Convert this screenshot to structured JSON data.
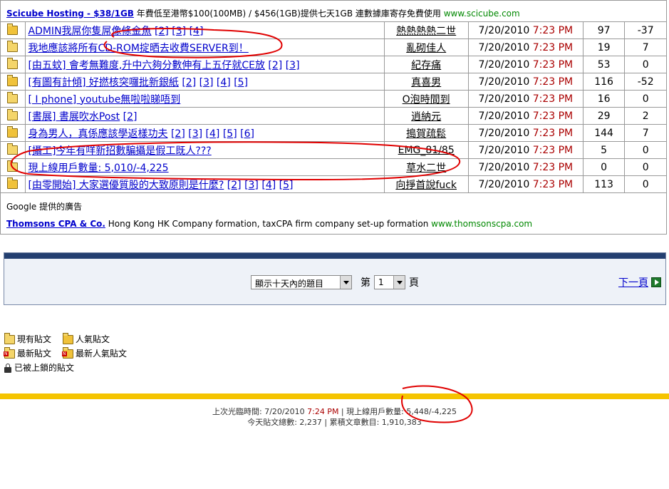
{
  "ad_top": {
    "link": "Scicube Hosting - $38/1GB",
    "text": " 年費低至港幣$100(100MB) / $456(1GB)提供七天1GB 連數據庫寄存免費使用 ",
    "url": "www.scicube.com"
  },
  "topics": [
    {
      "title": "ADMIN我屌你隻屌像條金魚",
      "pages": [
        "[2]",
        "[3]",
        "[4]"
      ],
      "author": "熱熱熱熱二世",
      "date": "7/20/2010",
      "time": "7:23 PM",
      "replies": "97",
      "views": "-37",
      "hot": true
    },
    {
      "title": "我地應該將所有CD-ROM掟晒去收費SERVER到！",
      "pages": [],
      "author": "亂砌佳人",
      "date": "7/20/2010",
      "time": "7:23 PM",
      "replies": "19",
      "views": "7",
      "hot": false
    },
    {
      "title": "[由五蚊] 會考無難度,升中六夠分數伸有上五仔就CE放",
      "pages": [
        "[2]",
        "[3]"
      ],
      "author": "紀存痛",
      "date": "7/20/2010",
      "time": "7:23 PM",
      "replies": "53",
      "views": "0",
      "hot": false
    },
    {
      "title": "[有圖有計傾] 好撚核突囉批新銀紙",
      "pages": [
        "[2]",
        "[3]",
        "[4]",
        "[5]"
      ],
      "author": "真喜男",
      "date": "7/20/2010",
      "time": "7:23 PM",
      "replies": "116",
      "views": "-52",
      "hot": true
    },
    {
      "title": "[ I phone] youtube無啦啦睇唔到",
      "pages": [],
      "author": "O泡時間到",
      "date": "7/20/2010",
      "time": "7:23 PM",
      "replies": "16",
      "views": "0",
      "hot": false
    },
    {
      "title": "[書展] 書展吹水Post",
      "pages": [
        "[2]"
      ],
      "author": "逍納元",
      "date": "7/20/2010",
      "time": "7:23 PM",
      "replies": "29",
      "views": "2",
      "hot": false
    },
    {
      "title": "身為男人，真係應該學返樣功夫",
      "pages": [
        "[2]",
        "[3]",
        "[4]",
        "[5]",
        "[6]"
      ],
      "author": "搗賀疏鬆",
      "date": "7/20/2010",
      "time": "7:23 PM",
      "replies": "144",
      "views": "7",
      "hot": true
    },
    {
      "title": "[攝工]今年有咩新招數騙攝是假工既人???",
      "pages": [],
      "author": "EMG_81/85",
      "date": "7/20/2010",
      "time": "7:23 PM",
      "replies": "5",
      "views": "0",
      "hot": false
    },
    {
      "title": "現上線用戶數量: 5,010/-4,225",
      "pages": [],
      "author": "草水二世",
      "date": "7/20/2010",
      "time": "7:23 PM",
      "replies": "0",
      "views": "0",
      "hot": false
    },
    {
      "title": "[由零開始] 大家選優質股的大致原則是什麼?",
      "pages": [
        "[2]",
        "[3]",
        "[4]",
        "[5]"
      ],
      "author": "向掙首說fuck",
      "date": "7/20/2010",
      "time": "7:23 PM",
      "replies": "113",
      "views": "0",
      "hot": true
    }
  ],
  "ad_bottom": {
    "google": "Google 提供的廣告",
    "link": "Thomsons CPA & Co.",
    "text": " Hong Kong HK Company formation, taxCPA firm company set-up formation ",
    "url": "www.thomsonscpa.com"
  },
  "nav": {
    "range_select": "顯示十天內的題目",
    "page_prefix": "第",
    "page_value": "1",
    "page_suffix": "頁",
    "next_label": "下一頁"
  },
  "legend": {
    "existing": "現有貼文",
    "popular": "人氣貼文",
    "newest": "最新貼文",
    "newest_popular": "最新人氣貼文",
    "locked": "已被上鎖的貼文"
  },
  "footer": {
    "last_visit_label": "上次光臨時間: 7/20/2010 ",
    "last_visit_time": "7:24 PM",
    "online_label": " | 現上線用戶數量: 5,448/-4,225",
    "line2": "今天貼文總數: 2,237 | 累積文章數目: 1,910,383"
  },
  "colors": {
    "annotation": "#e00000",
    "nav_bar": "#233f70",
    "footer_bar": "#f5c400"
  }
}
